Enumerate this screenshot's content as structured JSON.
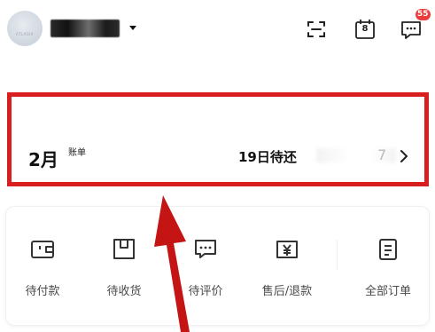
{
  "header": {
    "avatar_text": "ATLASIA",
    "calendar_day": "8",
    "message_badge": "55"
  },
  "bill": {
    "month": "2月",
    "label": "账单",
    "due_text": "19日待还",
    "amount_tail": "7",
    "highlight_color": "#d81e1e"
  },
  "orders": {
    "items": [
      {
        "label": "待付款",
        "icon": "wallet-icon"
      },
      {
        "label": "待收货",
        "icon": "package-icon"
      },
      {
        "label": "待评价",
        "icon": "comment-icon"
      },
      {
        "label": "售后/退款",
        "icon": "refund-icon"
      },
      {
        "label": "全部订单",
        "icon": "order-list-icon"
      }
    ]
  },
  "annotation": {
    "color": "#c41414"
  }
}
